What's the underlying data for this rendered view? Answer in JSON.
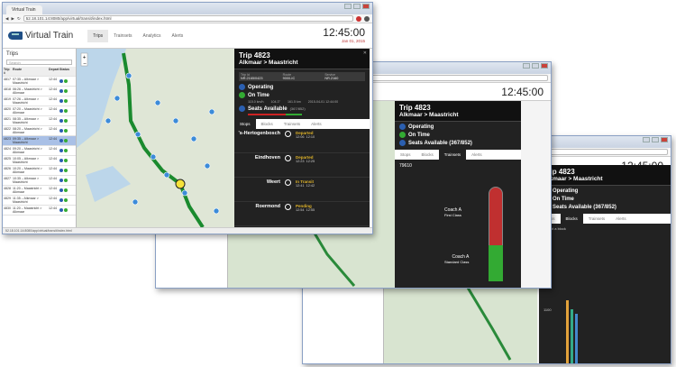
{
  "browser": {
    "tab_title": "Virtual Train",
    "url": "52.18.101.14:8080/app/virtual/transit/index.html"
  },
  "app": {
    "logo_text": "Virtual Train",
    "nav": [
      "Trips",
      "Trainsets",
      "Analytics",
      "Alerts"
    ],
    "clock": "12:45:00",
    "date": "Jan 01, 2015"
  },
  "trips": {
    "title": "Trips",
    "search_placeholder": "Search",
    "headers": [
      "Trip #",
      "Route",
      "Depart",
      "Status"
    ],
    "rows": [
      {
        "trip": "4817",
        "route": "07:35 – Alkmaar > Maastricht",
        "dep": "12:44"
      },
      {
        "trip": "4818",
        "route": "06:26 – Maastricht > Alkmaar",
        "dep": "12:44"
      },
      {
        "trip": "4819",
        "route": "07:26 – Alkmaar > Maastricht",
        "dep": "12:44"
      },
      {
        "trip": "4820",
        "route": "07:20 – Maastricht > Alkmaar",
        "dep": "12:44"
      },
      {
        "trip": "4821",
        "route": "08:35 – Alkmaar > Maastricht",
        "dep": "12:44"
      },
      {
        "trip": "4822",
        "route": "08:20 – Maastricht > Alkmaar",
        "dep": "12:44"
      },
      {
        "trip": "4823",
        "route": "09:35 – Alkmaar > Maastricht",
        "dep": "12:44"
      },
      {
        "trip": "4824",
        "route": "09:20 – Maastricht > Alkmaar",
        "dep": "12:44"
      },
      {
        "trip": "4825",
        "route": "10:05 – Alkmaar > Maastricht",
        "dep": "12:44"
      },
      {
        "trip": "4826",
        "route": "10:20 – Maastricht > Alkmaar",
        "dep": "12:44"
      },
      {
        "trip": "4827",
        "route": "10:35 – Alkmaar > Maastricht",
        "dep": "12:44"
      },
      {
        "trip": "4828",
        "route": "11:20 – Maastricht > Alkmaar",
        "dep": "12:44"
      },
      {
        "trip": "4829",
        "route": "11:35 – Alkmaar > Maastricht",
        "dep": "12:44"
      },
      {
        "trip": "4830",
        "route": "11:20 – Maastricht > Alkmaar",
        "dep": "12:44"
      }
    ]
  },
  "detail": {
    "title": "Trip 4823",
    "route": "Alkmaar > Maastricht",
    "grid": [
      {
        "label": "Trip Id",
        "value": "NR.2165/0423"
      },
      {
        "label": "Route",
        "value": "9000-IC"
      },
      {
        "label": "Service",
        "value": "NR.2160"
      }
    ],
    "operating": "Operating",
    "on_time": "On Time",
    "speed": "115.0 km/h",
    "heading": "104.3°",
    "distance": "161.5 km",
    "updated": "2015-04-01 12:44:00",
    "seats": "Seats Available",
    "seats_count": "(367/852)",
    "tabs": [
      "Stops",
      "Blocks",
      "Trainsets",
      "Alerts"
    ],
    "stops": [
      {
        "name": "'s-Hertogenbosch",
        "status": "Departed",
        "t1": "12:06",
        "t2": "12:10",
        "color": "#e0b42a"
      },
      {
        "name": "Eindhoven",
        "status": "Departed",
        "t1": "12:23",
        "t2": "12:25",
        "color": "#e0b42a"
      },
      {
        "name": "Weert",
        "status": "In Transit",
        "t1": "12:41",
        "t2": "12:42",
        "color": "#e0b42a"
      },
      {
        "name": "Roermond",
        "status": "Pending",
        "t1": "12:54",
        "t2": "12:55",
        "color": "#e0b42a"
      }
    ]
  },
  "second": {
    "clock": "12:45:00",
    "title": "Trip 4823",
    "route": "Alkmaar > Maastricht",
    "operating": "Operating",
    "on_time": "On Time",
    "seats": "Seats Available (367/852)",
    "tabs": [
      "Stops",
      "Blocks",
      "Trainsets",
      "Alerts"
    ],
    "trainset": "79610",
    "coach1": "Coach A",
    "coach1_class": "First Class",
    "coach2": "Coach A",
    "coach2_class": "Standard Class"
  },
  "third": {
    "clock": "12:45:00",
    "title": "Trip 4823",
    "route": "Alkmaar > Maastricht",
    "operating": "Operating",
    "on_time": "On Time",
    "seats": "Seats Available (367/852)",
    "tabs": [
      "Stops",
      "Blocks",
      "Trainsets",
      "Alerts"
    ],
    "select_label": "Select a block",
    "y1": "1000",
    "y2": "1100"
  }
}
